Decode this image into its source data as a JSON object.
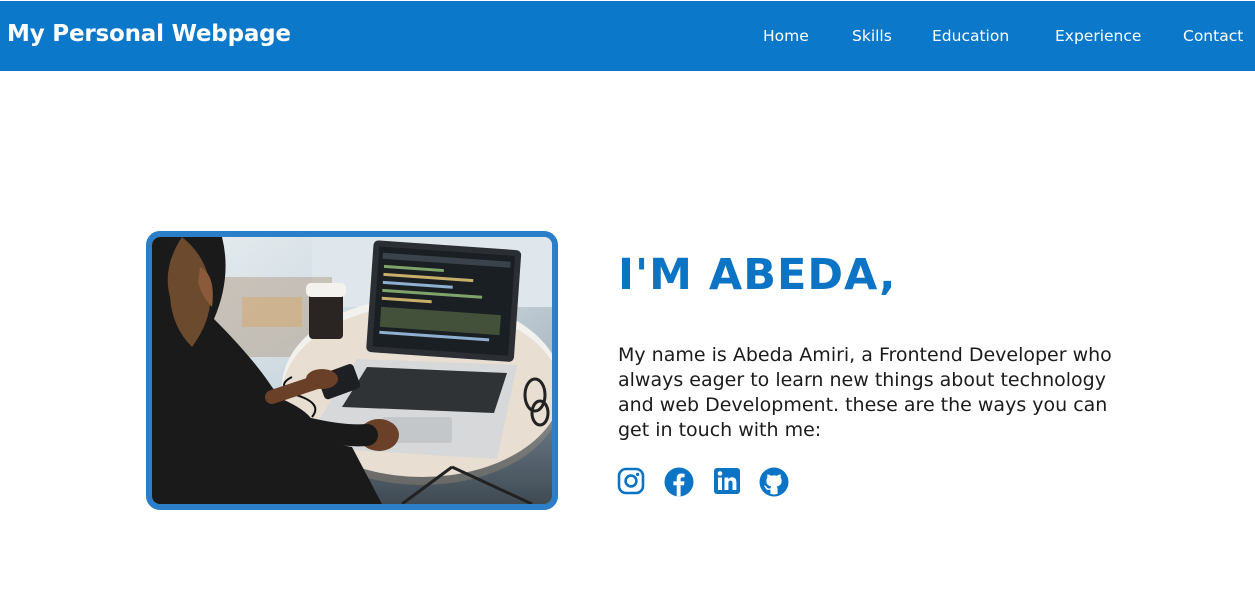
{
  "header": {
    "brand": "My Personal Webpage",
    "nav": [
      {
        "label": "Home"
      },
      {
        "label": "Skills"
      },
      {
        "label": "Education"
      },
      {
        "label": "Experience"
      },
      {
        "label": "Contact"
      }
    ]
  },
  "hero": {
    "heading": "I'M ABEDA,",
    "intro": "My name is Abeda Amiri, a Frontend Developer who always eager to learn new things about technology and web Development. these are the ways you can get in touch with me:",
    "photo_icon": "person-laptop-photo",
    "social": [
      {
        "icon": "instagram-icon"
      },
      {
        "icon": "facebook-icon"
      },
      {
        "icon": "linkedin-icon"
      },
      {
        "icon": "github-icon"
      }
    ]
  },
  "colors": {
    "nav_bg": "#0b78c9",
    "accent": "#0b74c4",
    "photo_border": "#2a7fc8"
  }
}
